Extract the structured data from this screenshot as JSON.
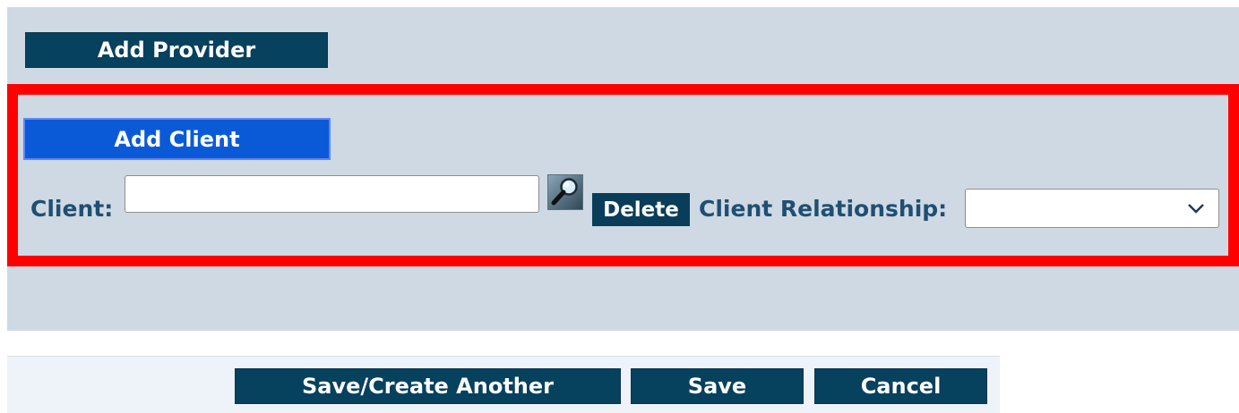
{
  "provider": {
    "add_button": "Add Provider"
  },
  "client": {
    "add_button": "Add Client",
    "label": "Client:",
    "input_value": "",
    "search_icon": "magnifier-search-icon",
    "delete_button": "Delete",
    "relationship_label": "Client Relationship:",
    "relationship_selected": ""
  },
  "footer": {
    "save_create_label": "Save/Create Another",
    "save_label": "Save",
    "cancel_label": "Cancel"
  },
  "colors": {
    "panel_background": "#cfd9e3",
    "button_navy": "#06415e",
    "focused_button_blue": "#0a5ad8",
    "highlight_red": "#ff0000",
    "label_blue": "#1f4f72"
  }
}
